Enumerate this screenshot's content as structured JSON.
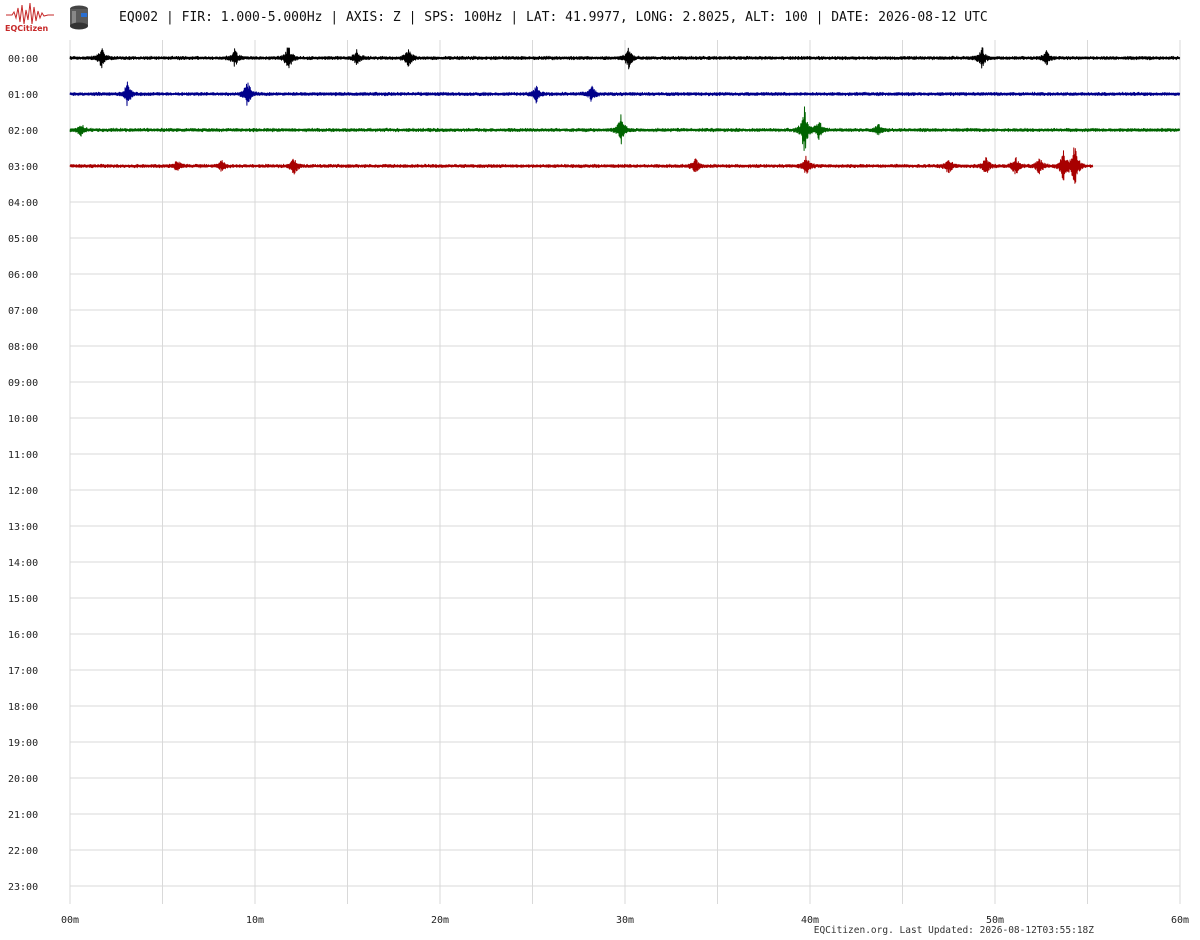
{
  "logo": {
    "text": "EQCitizen"
  },
  "title": "EQ002 | FIR: 1.000-5.000Hz | AXIS: Z | SPS: 100Hz | LAT: 41.9977, LONG: 2.8025, ALT: 100 | DATE: 2026-08-12 UTC",
  "footer": "EQCitizen.org. Last Updated: 2026-08-12T03:55:18Z",
  "colors": {
    "grid": "#d9d9d9",
    "logo": "#c62828",
    "trace_cycle": [
      "#000000",
      "#00008b",
      "#006400",
      "#a80000"
    ]
  },
  "chart_data": {
    "type": "line",
    "title": "",
    "xlabel": "",
    "ylabel": "",
    "x_ticks": [
      "00m",
      "10m",
      "20m",
      "30m",
      "40m",
      "50m",
      "60m"
    ],
    "x_range_minutes": [
      0,
      60
    ],
    "x_grid_step_minutes": 5,
    "y_ticks": [
      "00:00",
      "01:00",
      "02:00",
      "03:00",
      "04:00",
      "05:00",
      "06:00",
      "07:00",
      "08:00",
      "09:00",
      "10:00",
      "11:00",
      "12:00",
      "13:00",
      "14:00",
      "15:00",
      "16:00",
      "17:00",
      "18:00",
      "19:00",
      "20:00",
      "21:00",
      "22:00",
      "23:00"
    ],
    "grid": true,
    "series": [
      {
        "hour": "00:00",
        "color": "#000000",
        "end_minute": 60,
        "events": [
          {
            "minute": 1.7,
            "amplitude": 0.6
          },
          {
            "minute": 8.9,
            "amplitude": 0.5
          },
          {
            "minute": 11.8,
            "amplitude": 0.8
          },
          {
            "minute": 15.5,
            "amplitude": 0.45
          },
          {
            "minute": 18.3,
            "amplitude": 0.55
          },
          {
            "minute": 30.2,
            "amplitude": 0.6
          },
          {
            "minute": 49.3,
            "amplitude": 0.65
          },
          {
            "minute": 52.8,
            "amplitude": 0.4
          }
        ]
      },
      {
        "hour": "01:00",
        "color": "#00008b",
        "end_minute": 60,
        "events": [
          {
            "minute": 3.1,
            "amplitude": 0.7
          },
          {
            "minute": 9.6,
            "amplitude": 0.8
          },
          {
            "minute": 25.2,
            "amplitude": 0.5
          },
          {
            "minute": 28.2,
            "amplitude": 0.45
          }
        ]
      },
      {
        "hour": "02:00",
        "color": "#006400",
        "end_minute": 60,
        "events": [
          {
            "minute": 0.6,
            "amplitude": 0.35
          },
          {
            "minute": 29.8,
            "amplitude": 0.9
          },
          {
            "minute": 39.7,
            "amplitude": 1.5
          },
          {
            "minute": 40.5,
            "amplitude": 0.6
          },
          {
            "minute": 43.7,
            "amplitude": 0.3
          }
        ]
      },
      {
        "hour": "03:00",
        "color": "#a80000",
        "end_minute": 55.3,
        "events": [
          {
            "minute": 5.8,
            "amplitude": 0.3
          },
          {
            "minute": 8.2,
            "amplitude": 0.3
          },
          {
            "minute": 12.1,
            "amplitude": 0.5
          },
          {
            "minute": 33.8,
            "amplitude": 0.45
          },
          {
            "minute": 39.8,
            "amplitude": 0.6
          },
          {
            "minute": 47.5,
            "amplitude": 0.45
          },
          {
            "minute": 49.5,
            "amplitude": 0.55
          },
          {
            "minute": 51.1,
            "amplitude": 0.6
          },
          {
            "minute": 52.4,
            "amplitude": 0.5
          },
          {
            "minute": 53.7,
            "amplitude": 0.9
          },
          {
            "minute": 54.3,
            "amplitude": 1.4
          }
        ]
      }
    ]
  }
}
